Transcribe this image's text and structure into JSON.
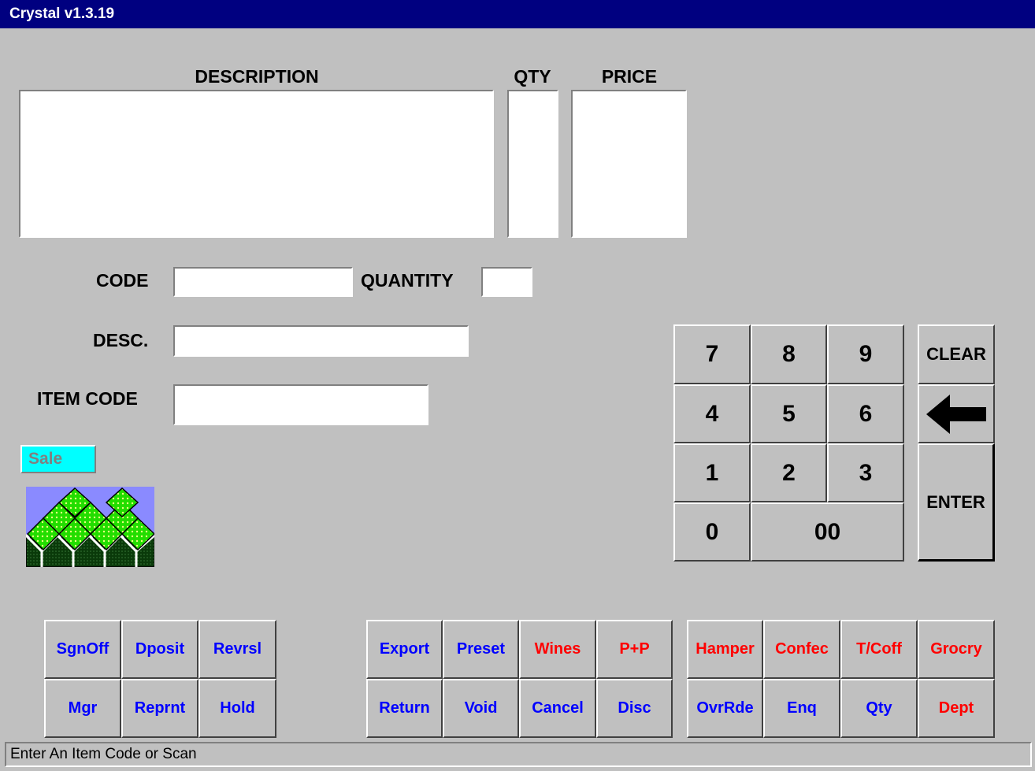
{
  "window": {
    "title": "Crystal v1.3.19"
  },
  "list_headers": {
    "description": "DESCRIPTION",
    "qty": "QTY",
    "price": "PRICE"
  },
  "form": {
    "code_label": "CODE",
    "quantity_label": "QUANTITY",
    "desc_label": "DESC.",
    "item_code_label": "ITEM CODE",
    "code_value": "",
    "quantity_value": "",
    "desc_value": "",
    "item_code_value": ""
  },
  "mode_badge": "Sale",
  "keypad": {
    "k7": "7",
    "k8": "8",
    "k9": "9",
    "k4": "4",
    "k5": "5",
    "k6": "6",
    "k1": "1",
    "k2": "2",
    "k3": "3",
    "k0": "0",
    "k00": "00",
    "clear": "CLEAR",
    "enter": "ENTER"
  },
  "function_buttons": {
    "group1": {
      "sgnoff": "SgnOff",
      "dposit": "Dposit",
      "revrsl": "Revrsl",
      "mgr": "Mgr",
      "reprnt": "Reprnt",
      "hold": "Hold"
    },
    "group2": {
      "export": "Export",
      "preset": "Preset",
      "wines": "Wines",
      "pp": "P+P",
      "return": "Return",
      "void": "Void",
      "cancel": "Cancel",
      "disc": "Disc"
    },
    "group3": {
      "hamper": "Hamper",
      "confec": "Confec",
      "tcoff": "T/Coff",
      "grocry": "Grocry",
      "ovrrde": "OvrRde",
      "enq": "Enq",
      "qty": "Qty",
      "dept": "Dept"
    }
  },
  "colors": {
    "titlebar": "#000080",
    "background": "#c0c0c0",
    "blue_text": "#0000ff",
    "red_text": "#ff0000",
    "mode_badge": "#00ffff"
  },
  "status": {
    "message": "Enter An Item Code or Scan"
  }
}
